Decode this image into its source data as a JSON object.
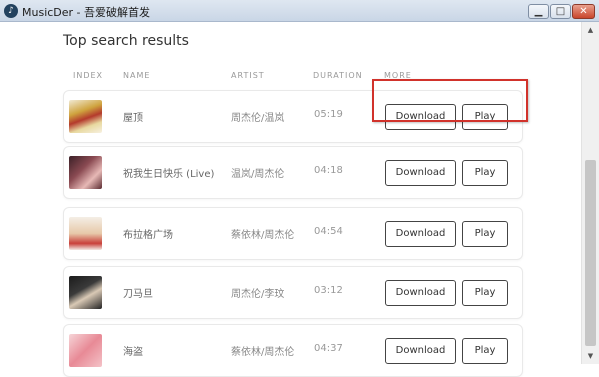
{
  "window": {
    "title": "MusicDer - 吾爱破解首发",
    "app_icon": "music-note-icon",
    "controls": {
      "minimize": "▁",
      "maximize": "□",
      "close": "✕"
    }
  },
  "main": {
    "heading": "Top search results",
    "columns": {
      "index": "INDEX",
      "name": "NAME",
      "artist": "ARTIST",
      "duration": "DURATION",
      "more": "MORE"
    },
    "rows": [
      {
        "name": "屋顶",
        "artist": "周杰伦/温岚",
        "duration": "05:19",
        "download": "Download",
        "play": "Play"
      },
      {
        "name": "祝我生日快乐 (Live)",
        "artist": "温岚/周杰伦",
        "duration": "04:18",
        "download": "Download",
        "play": "Play"
      },
      {
        "name": "布拉格广场",
        "artist": "蔡依林/周杰伦",
        "duration": "04:54",
        "download": "Download",
        "play": "Play"
      },
      {
        "name": "刀马旦",
        "artist": "周杰伦/李玟",
        "duration": "03:12",
        "download": "Download",
        "play": "Play"
      },
      {
        "name": "海盗",
        "artist": "蔡依林/周杰伦",
        "duration": "04:37",
        "download": "Download",
        "play": "Play"
      }
    ]
  },
  "colors": {
    "highlight": "#d1322b",
    "button_border": "#444444"
  }
}
